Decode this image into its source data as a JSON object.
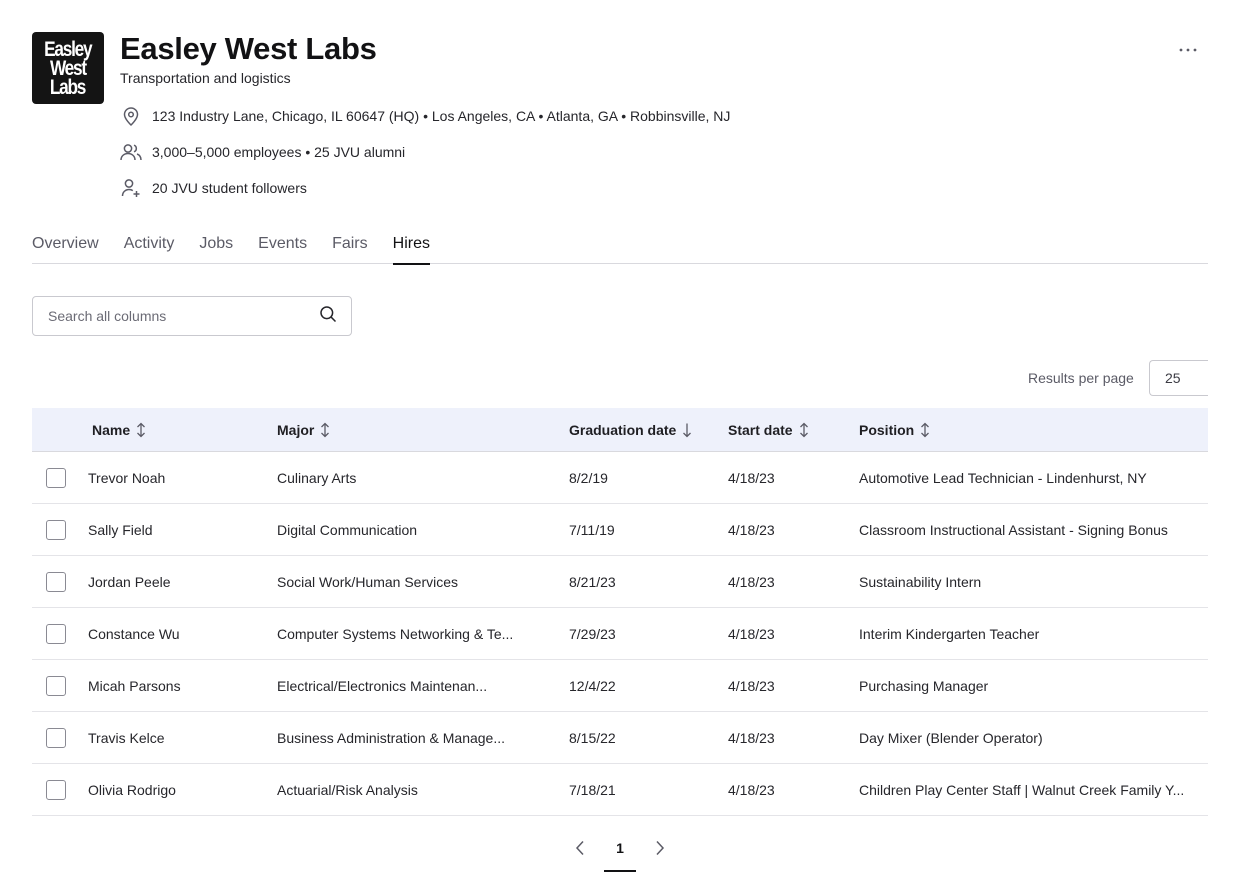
{
  "company": {
    "logo_lines": [
      "Easley",
      "West",
      "Labs"
    ],
    "name": "Easley West Labs",
    "industry": "Transportation and logistics",
    "locations": "123 Industry Lane, Chicago, IL 60647 (HQ) • Los Angeles, CA • Atlanta, GA • Robbinsville, NJ",
    "employees": "3,000–5,000 employees • 25 JVU alumni",
    "followers": "20 JVU student followers"
  },
  "tabs": [
    {
      "label": "Overview"
    },
    {
      "label": "Activity"
    },
    {
      "label": "Jobs"
    },
    {
      "label": "Events"
    },
    {
      "label": "Fairs"
    },
    {
      "label": "Hires",
      "active": true
    }
  ],
  "search": {
    "placeholder": "Search all columns"
  },
  "results_per_page": {
    "label": "Results per page",
    "value": "25"
  },
  "table": {
    "columns": {
      "name": "Name",
      "major": "Major",
      "graduation": "Graduation date",
      "start": "Start date",
      "position": "Position"
    },
    "rows": [
      {
        "name": "Trevor Noah",
        "major": "Culinary Arts",
        "graduation": "8/2/19",
        "start": "4/18/23",
        "position": "Automotive Lead Technician - Lindenhurst, NY"
      },
      {
        "name": "Sally Field",
        "major": "Digital Communication",
        "graduation": "7/11/19",
        "start": "4/18/23",
        "position": "Classroom Instructional Assistant - Signing Bonus"
      },
      {
        "name": "Jordan Peele",
        "major": "Social Work/Human Services",
        "graduation": "8/21/23",
        "start": "4/18/23",
        "position": "Sustainability Intern"
      },
      {
        "name": "Constance Wu",
        "major": "Computer Systems Networking & Te...",
        "graduation": "7/29/23",
        "start": "4/18/23",
        "position": "Interim Kindergarten Teacher"
      },
      {
        "name": "Micah Parsons",
        "major": "Electrical/Electronics Maintenan...",
        "graduation": "12/4/22",
        "start": "4/18/23",
        "position": "Purchasing Manager"
      },
      {
        "name": "Travis Kelce",
        "major": "Business Administration & Manage...",
        "graduation": "8/15/22",
        "start": "4/18/23",
        "position": "Day Mixer (Blender Operator)"
      },
      {
        "name": "Olivia Rodrigo",
        "major": "Actuarial/Risk Analysis",
        "graduation": "7/18/21",
        "start": "4/18/23",
        "position": "Children Play Center Staff  | Walnut Creek Family Y..."
      }
    ]
  },
  "pagination": {
    "current_page": "1"
  },
  "icons": {
    "more": "more-horizontal-icon",
    "location": "map-pin-icon",
    "employees": "users-icon",
    "followers": "user-plus-icon",
    "search": "search-icon",
    "sort": "sort-icon",
    "sort_desc": "arrow-down-icon",
    "prev": "chevron-left-icon",
    "next": "chevron-right-icon"
  }
}
